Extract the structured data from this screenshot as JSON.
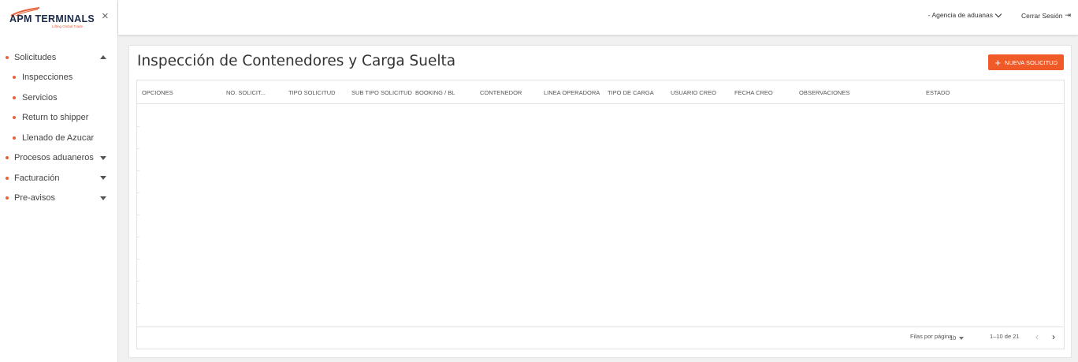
{
  "brand": {
    "name": "APM TERMINALS",
    "tagline": "Lifting Global Trade",
    "close_icon": "close-icon",
    "accent": "#e8623a"
  },
  "sidebar": {
    "items": [
      {
        "label": "Solicitudes",
        "caret": "up"
      },
      {
        "label": "Inspecciones",
        "sub": true
      },
      {
        "label": "Servicios",
        "sub": true
      },
      {
        "label": "Return to shipper",
        "sub": true
      },
      {
        "label": "Llenado de Azucar",
        "sub": true
      },
      {
        "label": "Procesos aduaneros",
        "caret": "down"
      },
      {
        "label": "Facturación",
        "caret": "down"
      },
      {
        "label": "Pre-avisos",
        "caret": "down"
      }
    ]
  },
  "header": {
    "agency_label": "- Agencia de aduanas",
    "logout_label": "Cerrar Sesión",
    "logout_icon": "⇥"
  },
  "main": {
    "title": "Inspección de Contenedores y Carga Suelta",
    "new_button": {
      "icon": "+",
      "label": "NUEVA SOLICITUD",
      "color": "#f05a28"
    },
    "columns": [
      "OPCIONES",
      "NO. SOLICIT...",
      "TIPO SOLICITUD",
      "SUB TIPO SOLICITUD",
      "BOOKING / BL",
      "CONTENEDOR",
      "LINEA OPERADORA",
      "TIPO DE CARGA",
      "USUARIO CREO",
      "FECHA CREO",
      "OBSERVACIONES",
      "ESTADO"
    ],
    "pagination": {
      "rows_label": "Filas por página:",
      "rows_value": "10",
      "range": "1–10 de 21",
      "prev": "‹",
      "next": "›"
    }
  }
}
